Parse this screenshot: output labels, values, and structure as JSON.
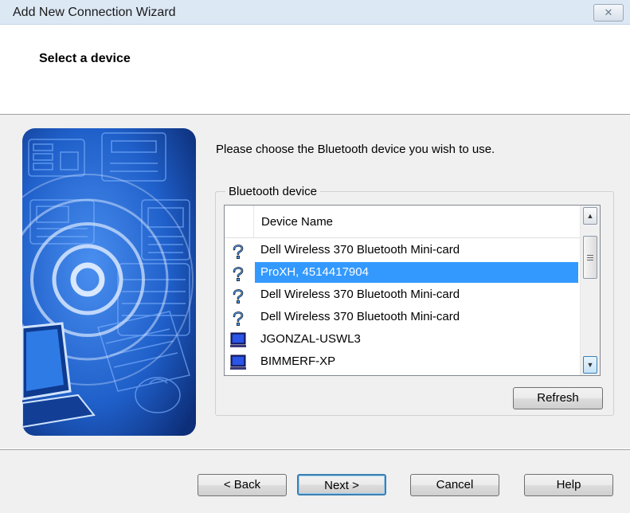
{
  "window": {
    "title": "Add New Connection Wizard",
    "close_glyph": "✕"
  },
  "header": {
    "title": "Select a device"
  },
  "content": {
    "prompt": "Please choose the Bluetooth device you wish to use.",
    "group_label": "Bluetooth device",
    "list": {
      "column_header": "Device Name",
      "rows": [
        {
          "name": "Dell Wireless 370 Bluetooth Mini-card",
          "icon": "bluetooth-unknown-icon",
          "selected": false
        },
        {
          "name": "ProXH, 4514417904",
          "icon": "bluetooth-unknown-icon",
          "selected": true
        },
        {
          "name": "Dell Wireless 370 Bluetooth Mini-card",
          "icon": "bluetooth-unknown-icon",
          "selected": false
        },
        {
          "name": "Dell Wireless 370 Bluetooth Mini-card",
          "icon": "bluetooth-unknown-icon",
          "selected": false
        },
        {
          "name": "JGONZAL-USWL3",
          "icon": "computer-icon",
          "selected": false
        },
        {
          "name": "BIMMERF-XP",
          "icon": "computer-icon",
          "selected": false
        }
      ]
    },
    "refresh_label": "Refresh"
  },
  "footer": {
    "back_label": "< Back",
    "next_label": "Next >",
    "cancel_label": "Cancel",
    "help_label": "Help"
  },
  "colors": {
    "selection": "#3399ff",
    "titlebar": "#dde8f5",
    "dialog_bg": "#f0f0f0",
    "art_blue": "#1f5fc9"
  }
}
